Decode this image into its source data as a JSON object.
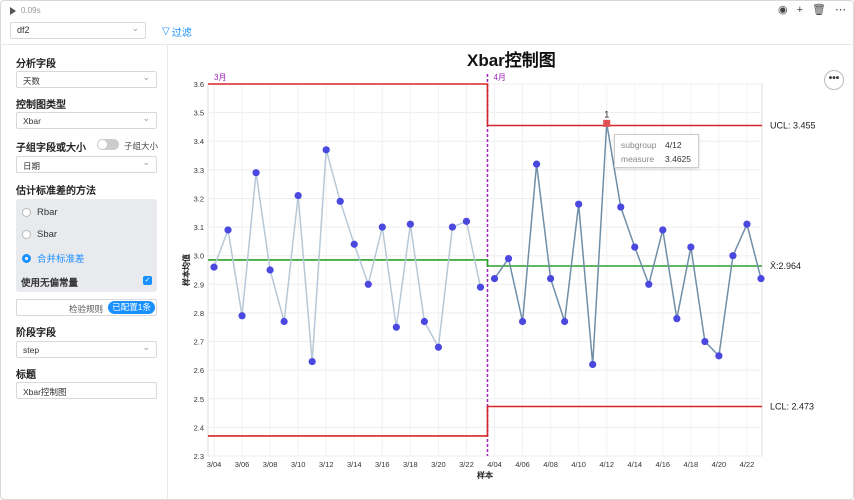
{
  "topbar": {
    "run_time": "0.09s",
    "actions": [
      "eye-icon",
      "plus-icon",
      "trash-icon",
      "more-icon"
    ]
  },
  "dataset": {
    "value": "df2"
  },
  "filter": {
    "label": "过滤"
  },
  "sidebar": {
    "analysis_field_label": "分析字段",
    "analysis_field_value": "天数",
    "chart_type_label": "控制图类型",
    "chart_type_value": "Xbar",
    "subgroup_label": "子组字段或大小",
    "subgroup_toggle_label": "子组大小",
    "subgroup_value": "日期",
    "method_label": "估计标准差的方法",
    "methods": [
      {
        "label": "Rbar",
        "selected": false
      },
      {
        "label": "Sbar",
        "selected": false
      },
      {
        "label": "合并标准差",
        "selected": true
      }
    ],
    "unbiased_label": "使用无偏常量",
    "rule_label": "检验规则",
    "rule_badge": "已配置1条",
    "stage_label": "阶段字段",
    "stage_value": "step",
    "title_label": "标题",
    "title_value": "Xbar控制图"
  },
  "chart_data": {
    "type": "line",
    "title": "Xbar控制图",
    "xlabel": "样本",
    "ylabel": "样本均值",
    "ylim": [
      2.3,
      3.6
    ],
    "yticks": [
      "2.3",
      "2.4",
      "2.5",
      "2.6",
      "2.7",
      "2.8",
      "2.9",
      "3.0",
      "3.1",
      "3.2",
      "3.3",
      "3.4",
      "3.5",
      "3.6"
    ],
    "xticks": [
      "3/04",
      "3/06",
      "3/08",
      "3/10",
      "3/12",
      "3/14",
      "3/16",
      "3/18",
      "3/20",
      "3/22",
      "4/04",
      "4/06",
      "4/08",
      "4/10",
      "4/12",
      "4/14",
      "4/16",
      "4/18",
      "4/20",
      "4/22"
    ],
    "phases": [
      {
        "name": "3月",
        "dates": [
          "3/04",
          "3/05",
          "3/06",
          "3/07",
          "3/08",
          "3/09",
          "3/10",
          "3/11",
          "3/12",
          "3/13",
          "3/14",
          "3/15",
          "3/16",
          "3/17",
          "3/18",
          "3/19",
          "3/20",
          "3/21",
          "3/22",
          "3/23"
        ],
        "values": [
          2.96,
          3.09,
          2.79,
          3.29,
          2.95,
          2.77,
          3.21,
          2.63,
          3.37,
          3.19,
          3.04,
          2.9,
          3.1,
          2.75,
          3.11,
          2.77,
          2.68,
          3.1,
          3.12,
          2.89
        ],
        "ucl": 3.6,
        "center": 2.985,
        "lcl": 2.37
      },
      {
        "name": "4月",
        "dates": [
          "4/04",
          "4/05",
          "4/06",
          "4/07",
          "4/08",
          "4/09",
          "4/10",
          "4/11",
          "4/12",
          "4/13",
          "4/14",
          "4/15",
          "4/16",
          "4/17",
          "4/18",
          "4/19",
          "4/20",
          "4/21",
          "4/22",
          "4/23"
        ],
        "values": [
          2.92,
          2.99,
          2.77,
          3.32,
          2.92,
          2.77,
          3.18,
          2.62,
          3.4625,
          3.17,
          3.03,
          2.9,
          3.09,
          2.78,
          3.03,
          2.7,
          2.65,
          3.0,
          3.11,
          2.92
        ],
        "ucl": 3.455,
        "center": 2.964,
        "lcl": 2.473
      }
    ],
    "labels": {
      "ucl": "UCL: 3.455",
      "center": "X̄:2.964",
      "lcl": "LCL: 2.473"
    },
    "violation": {
      "index_phase": 1,
      "index_point": 8,
      "mark": "1"
    },
    "colors": {
      "limit": "#d62728",
      "center": "#2ca02c",
      "line1": "#b7c9d8",
      "line2": "#6f8fa8",
      "point": "#4b48e0",
      "violation": "#e05050",
      "divider": "#9b26b6"
    }
  },
  "tooltip": {
    "subgroup_label": "subgroup",
    "subgroup_value": "4/12",
    "measure_label": "measure",
    "measure_value": "3.4625"
  }
}
